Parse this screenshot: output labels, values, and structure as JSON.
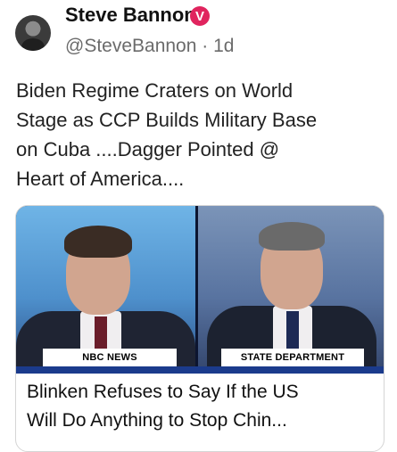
{
  "post": {
    "author_name": "Steve Bannon",
    "verified_glyph": "V",
    "handle_time": "@SteveBannon · 1d",
    "text_lines": [
      "Biden Regime Craters on World",
      "Stage as CCP Builds Military Base",
      "on Cuba ....Dagger Pointed  @",
      "Heart of America...."
    ]
  },
  "card": {
    "left_caption": "NBC NEWS",
    "right_caption": "STATE DEPARTMENT",
    "headline_lines": [
      "Blinken Refuses to Say If the US",
      "Will Do Anything to Stop Chin..."
    ]
  },
  "colors": {
    "badge": "#e0245e",
    "handle": "#6b6b6b",
    "strip": "#1b3b8c"
  }
}
